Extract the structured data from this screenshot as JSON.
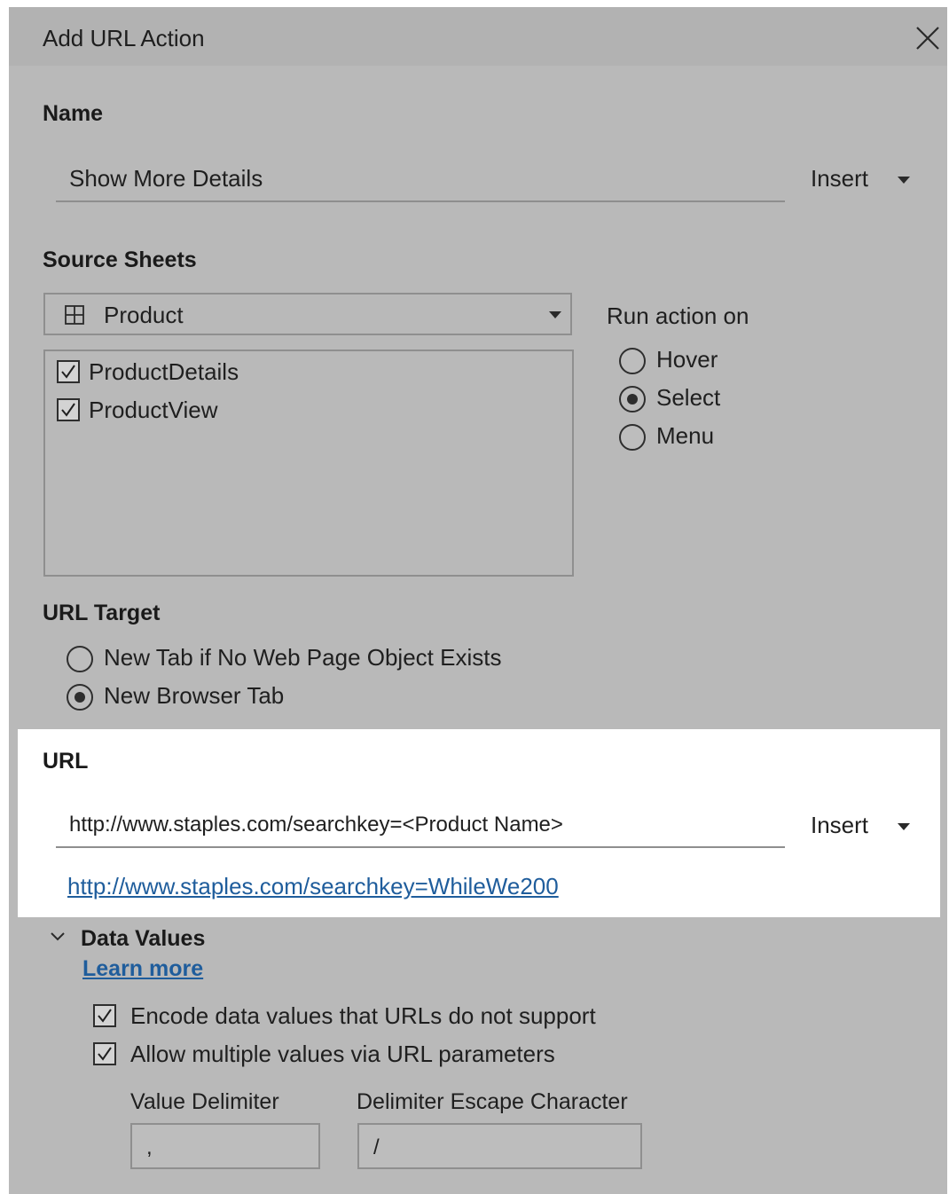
{
  "dialog": {
    "title": "Add URL Action"
  },
  "name_section": {
    "label": "Name",
    "value": "Show More Details",
    "insert_label": "Insert"
  },
  "source_sheets": {
    "label": "Source Sheets",
    "selected_datasource": "Product",
    "sheets": [
      {
        "label": "ProductDetails",
        "checked": true
      },
      {
        "label": "ProductView",
        "checked": true
      }
    ]
  },
  "run_action": {
    "label": "Run action on",
    "options": [
      {
        "label": "Hover",
        "selected": false
      },
      {
        "label": "Select",
        "selected": true
      },
      {
        "label": "Menu",
        "selected": false
      }
    ]
  },
  "url_target": {
    "label": "URL Target",
    "options": [
      {
        "label": "New Tab if No Web Page Object Exists",
        "selected": false
      },
      {
        "label": "New Browser Tab",
        "selected": true
      }
    ]
  },
  "url_section": {
    "label": "URL",
    "value": "http://www.staples.com/searchkey=<Product Name>",
    "insert_label": "Insert",
    "preview_link": "http://www.staples.com/searchkey=WhileWe200"
  },
  "data_values": {
    "label": "Data Values",
    "learn_more": "Learn more",
    "options": [
      {
        "label": "Encode data values that URLs do not support",
        "checked": true
      },
      {
        "label": "Allow multiple values via URL parameters",
        "checked": true
      }
    ],
    "value_delimiter_label": "Value Delimiter",
    "value_delimiter": ",",
    "escape_char_label": "Delimiter Escape Character",
    "escape_char": "/"
  },
  "colors": {
    "dialog_bg": "#b9b9b9",
    "highlight_bg": "#ffffff",
    "link": "#1f5d9c"
  }
}
